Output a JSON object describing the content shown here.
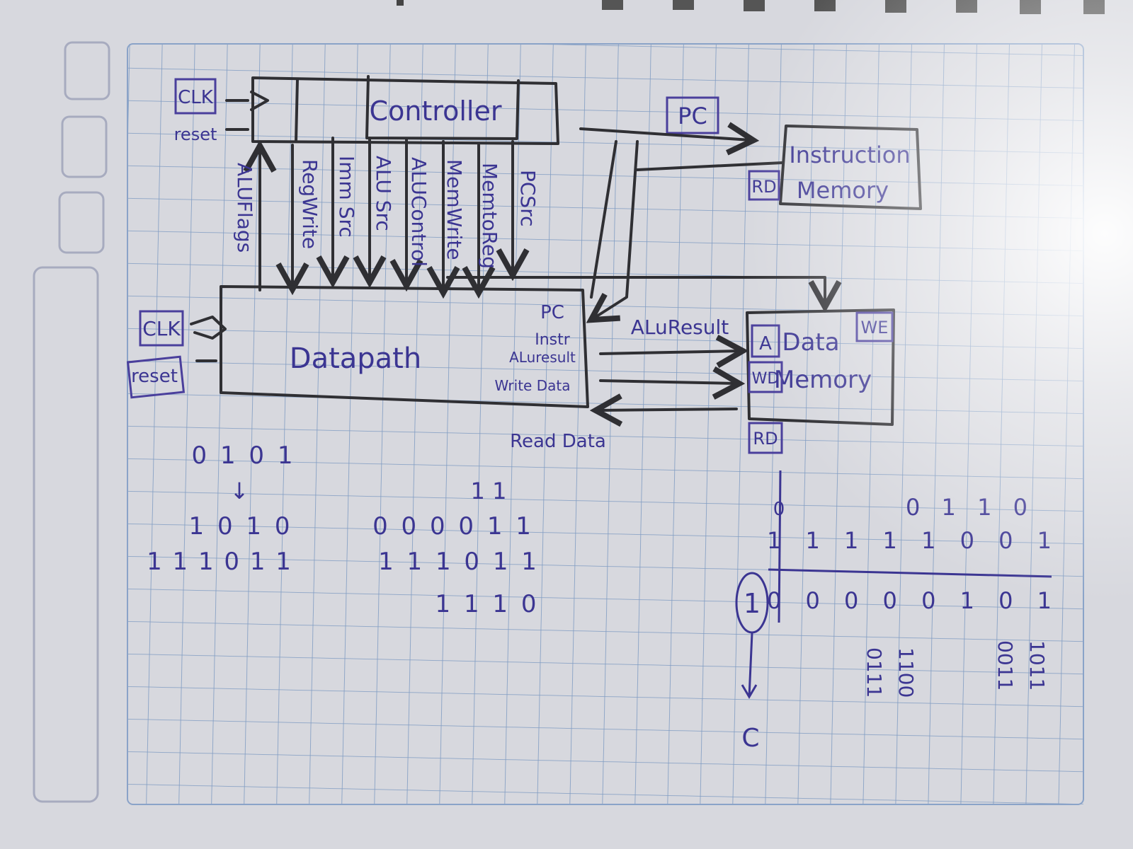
{
  "diagram": {
    "controller": {
      "label": "Controller",
      "clk": "CLK",
      "reset": "reset"
    },
    "control_signals": [
      "ALUFlags",
      "RegWrite",
      "Imm Src",
      "ALU Src",
      "ALUControl",
      "MemWrite",
      "MemtoReg",
      "PCSrc"
    ],
    "datapath": {
      "label": "Datapath",
      "clk": "CLK",
      "reset": "reset",
      "ports": [
        "PC",
        "Instr",
        "ALuresult",
        "Write Data"
      ]
    },
    "pc_label": "PC",
    "instruction_memory": {
      "label_line1": "Instruction",
      "label_line2": "Memory",
      "rd": "RD"
    },
    "data_memory": {
      "label_line1": "Data",
      "label_line2": "Memory",
      "a": "A",
      "wd": "WD",
      "we": "WE",
      "rd": "RD"
    },
    "alu_result_label": "ALuResult",
    "read_data_label": "Read Data"
  },
  "scratch_work": {
    "left": [
      "0 1 0 1",
      "↓",
      "1 0 1 0",
      "1 1 1 0 1 1"
    ],
    "middle": [
      "1  1",
      "0 0 0 0 1 1",
      "1 1  1 0 1 1",
      "1 1 1 0"
    ],
    "right_top": [
      "0 1 1 0",
      "1 1 1 1 1 0 0 1"
    ],
    "right_row": [
      "0 0 0 0 0 1 0 1"
    ],
    "circled_one": "1",
    "c_label": "C",
    "right_zero": "0",
    "vertical_numbers": [
      "0111",
      "1100",
      "0011",
      "1011"
    ]
  }
}
